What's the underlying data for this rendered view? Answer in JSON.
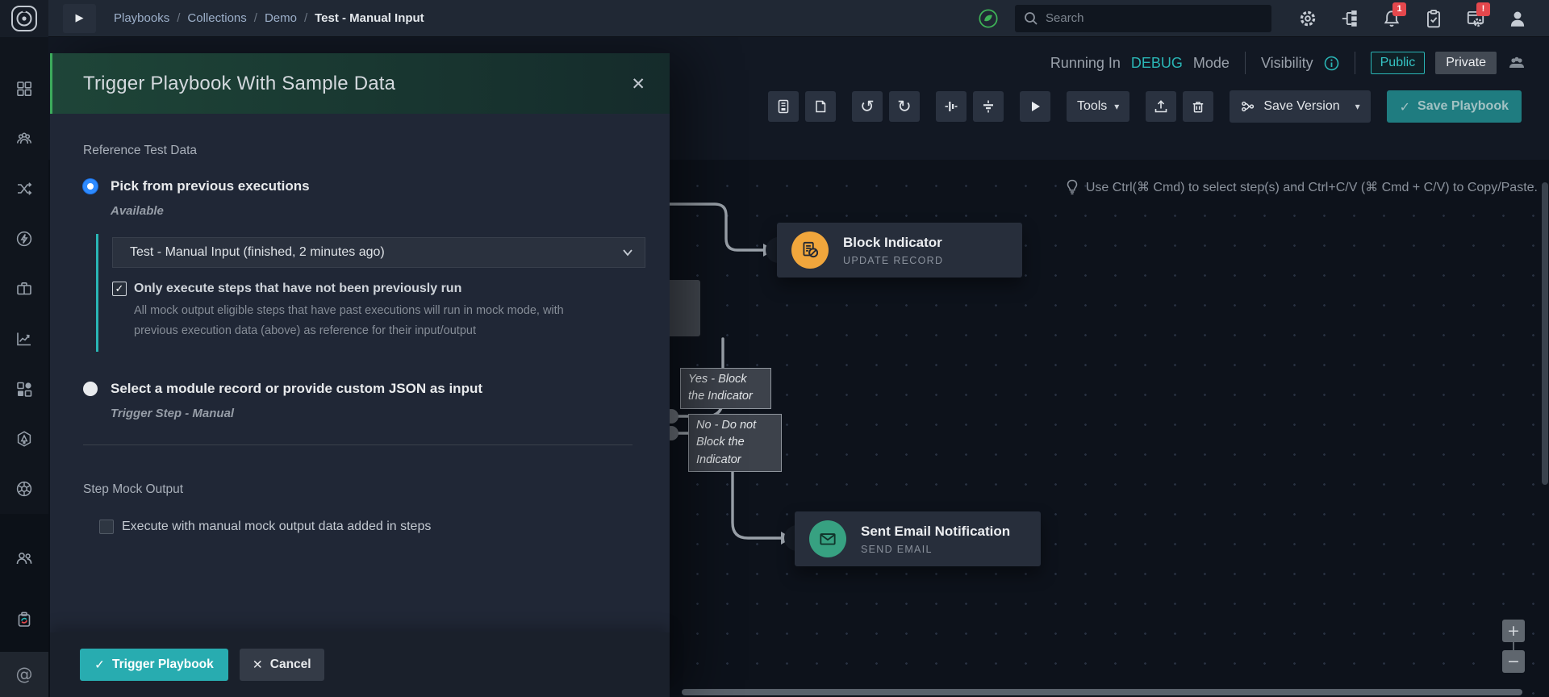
{
  "icons": {
    "check": "✓",
    "close": "✕",
    "caret": "▾",
    "play": "▶",
    "undo": "↺",
    "redo": "↻",
    "plus": "+",
    "minus": "−",
    "at": "@",
    "slash": "/"
  },
  "topbar": {
    "breadcrumb": {
      "items": [
        "Playbooks",
        "Collections",
        "Demo"
      ],
      "current": "Test - Manual Input"
    },
    "search_placeholder": "Search",
    "bell_badge": "1",
    "system_badge": "!"
  },
  "sidebar": {
    "icon_names": [
      "dashboard",
      "incidents",
      "playbooks",
      "automation",
      "cases",
      "reports",
      "widgets",
      "connectors",
      "settings-wheel",
      "users",
      "recycle-bin",
      "mentions"
    ]
  },
  "canvas": {
    "running_prefix": "Running In",
    "mode": "DEBUG",
    "running_suffix": "Mode",
    "visibility_label": "Visibility",
    "public_label": "Public",
    "private_label": "Private",
    "tools_label": "Tools",
    "save_version_label": "Save Version",
    "save_playbook_label": "Save Playbook",
    "hint": "Use Ctrl(⌘ Cmd) to select step(s) and Ctrl+C/V (⌘ Cmd + C/V) to Copy/Paste.",
    "nodes": [
      {
        "title": "Block Indicator",
        "subtitle": "UPDATE RECORD"
      },
      {
        "title": "Sent Email Notification",
        "subtitle": "SEND EMAIL"
      }
    ],
    "edge_labels": [
      {
        "text": "Yes - Block\nthe Indicator"
      },
      {
        "text": "No - Do not\nBlock the\nIndicator"
      }
    ]
  },
  "modal": {
    "title": "Trigger Playbook With Sample Data",
    "section1_label": "Reference Test Data",
    "radio1_label": "Pick from previous executions",
    "radio1_sub": "Available",
    "dropdown_value": "Test - Manual Input (finished, 2 minutes ago)",
    "checkbox1_label": "Only execute steps that have not been previously run",
    "checkbox1_help": "All mock output eligible steps that have past executions will run in mock mode, with previous execution data (above) as reference for their input/output",
    "radio2_label": "Select a module record or provide custom JSON as input",
    "radio2_sub": "Trigger Step - Manual",
    "section2_label": "Step Mock Output",
    "checkbox2_label": "Execute with manual mock output data added in steps",
    "trigger_button": "Trigger Playbook",
    "cancel_button": "Cancel"
  },
  "colors": {
    "accent_teal": "#28acb0",
    "accent_green": "#3cab5c",
    "accent_blue": "#2e8bff",
    "badge_red": "#e5484d"
  }
}
